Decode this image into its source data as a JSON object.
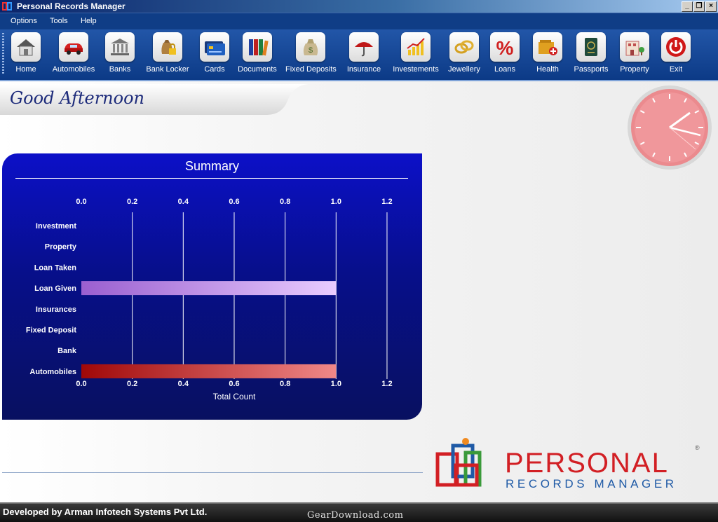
{
  "window": {
    "title": "Personal Records Manager"
  },
  "menu": [
    "Options",
    "Tools",
    "Help"
  ],
  "toolbar": [
    {
      "label": "Home",
      "icon": "home-icon"
    },
    {
      "label": "Automobiles",
      "icon": "car-icon"
    },
    {
      "label": "Banks",
      "icon": "bank-icon"
    },
    {
      "label": "Bank Locker",
      "icon": "locker-icon"
    },
    {
      "label": "Cards",
      "icon": "card-icon"
    },
    {
      "label": "Documents",
      "icon": "documents-icon"
    },
    {
      "label": "Fixed Deposits",
      "icon": "money-bag-icon"
    },
    {
      "label": "Insurance",
      "icon": "umbrella-icon"
    },
    {
      "label": "Investements",
      "icon": "growth-chart-icon"
    },
    {
      "label": "Jewellery",
      "icon": "rings-icon"
    },
    {
      "label": "Loans",
      "icon": "percent-icon"
    },
    {
      "label": "Health",
      "icon": "health-icon"
    },
    {
      "label": "Passports",
      "icon": "passport-icon"
    },
    {
      "label": "Property",
      "icon": "house-icon"
    },
    {
      "label": "Exit",
      "icon": "power-icon"
    }
  ],
  "greeting": "Good Afternoon",
  "summary": {
    "title": "Summary"
  },
  "chart_data": {
    "type": "bar",
    "orientation": "horizontal",
    "categories": [
      "Investment",
      "Property",
      "Loan Taken",
      "Loan Given",
      "Insurances",
      "Fixed Deposit",
      "Bank",
      "Automobiles"
    ],
    "values": [
      0,
      0,
      0,
      1,
      0,
      0,
      0,
      1
    ],
    "xlabel": "Total Count",
    "xlim": [
      0,
      1.2
    ],
    "ticks": [
      "0.0",
      "0.2",
      "0.4",
      "0.6",
      "0.8",
      "1.0",
      "1.2"
    ],
    "grid": true,
    "colors": {
      "Loan Given": [
        "#9a5fd0",
        "#e8ccff"
      ],
      "Automobiles": [
        "#a00808",
        "#f08888"
      ]
    }
  },
  "logo": {
    "word1": "PERSONAL",
    "word2": "RECORDS MANAGER",
    "mark": "®"
  },
  "status": {
    "developer": "Developed by Arman Infotech Systems Pvt Ltd.",
    "watermark": "GearDownload.com"
  },
  "colors": {
    "titlebar": "#0a246a",
    "toolbar": "#0c3a86",
    "chart_bg": "#081060",
    "logo_red": "#d21f24",
    "logo_blue": "#1f5aa6"
  }
}
